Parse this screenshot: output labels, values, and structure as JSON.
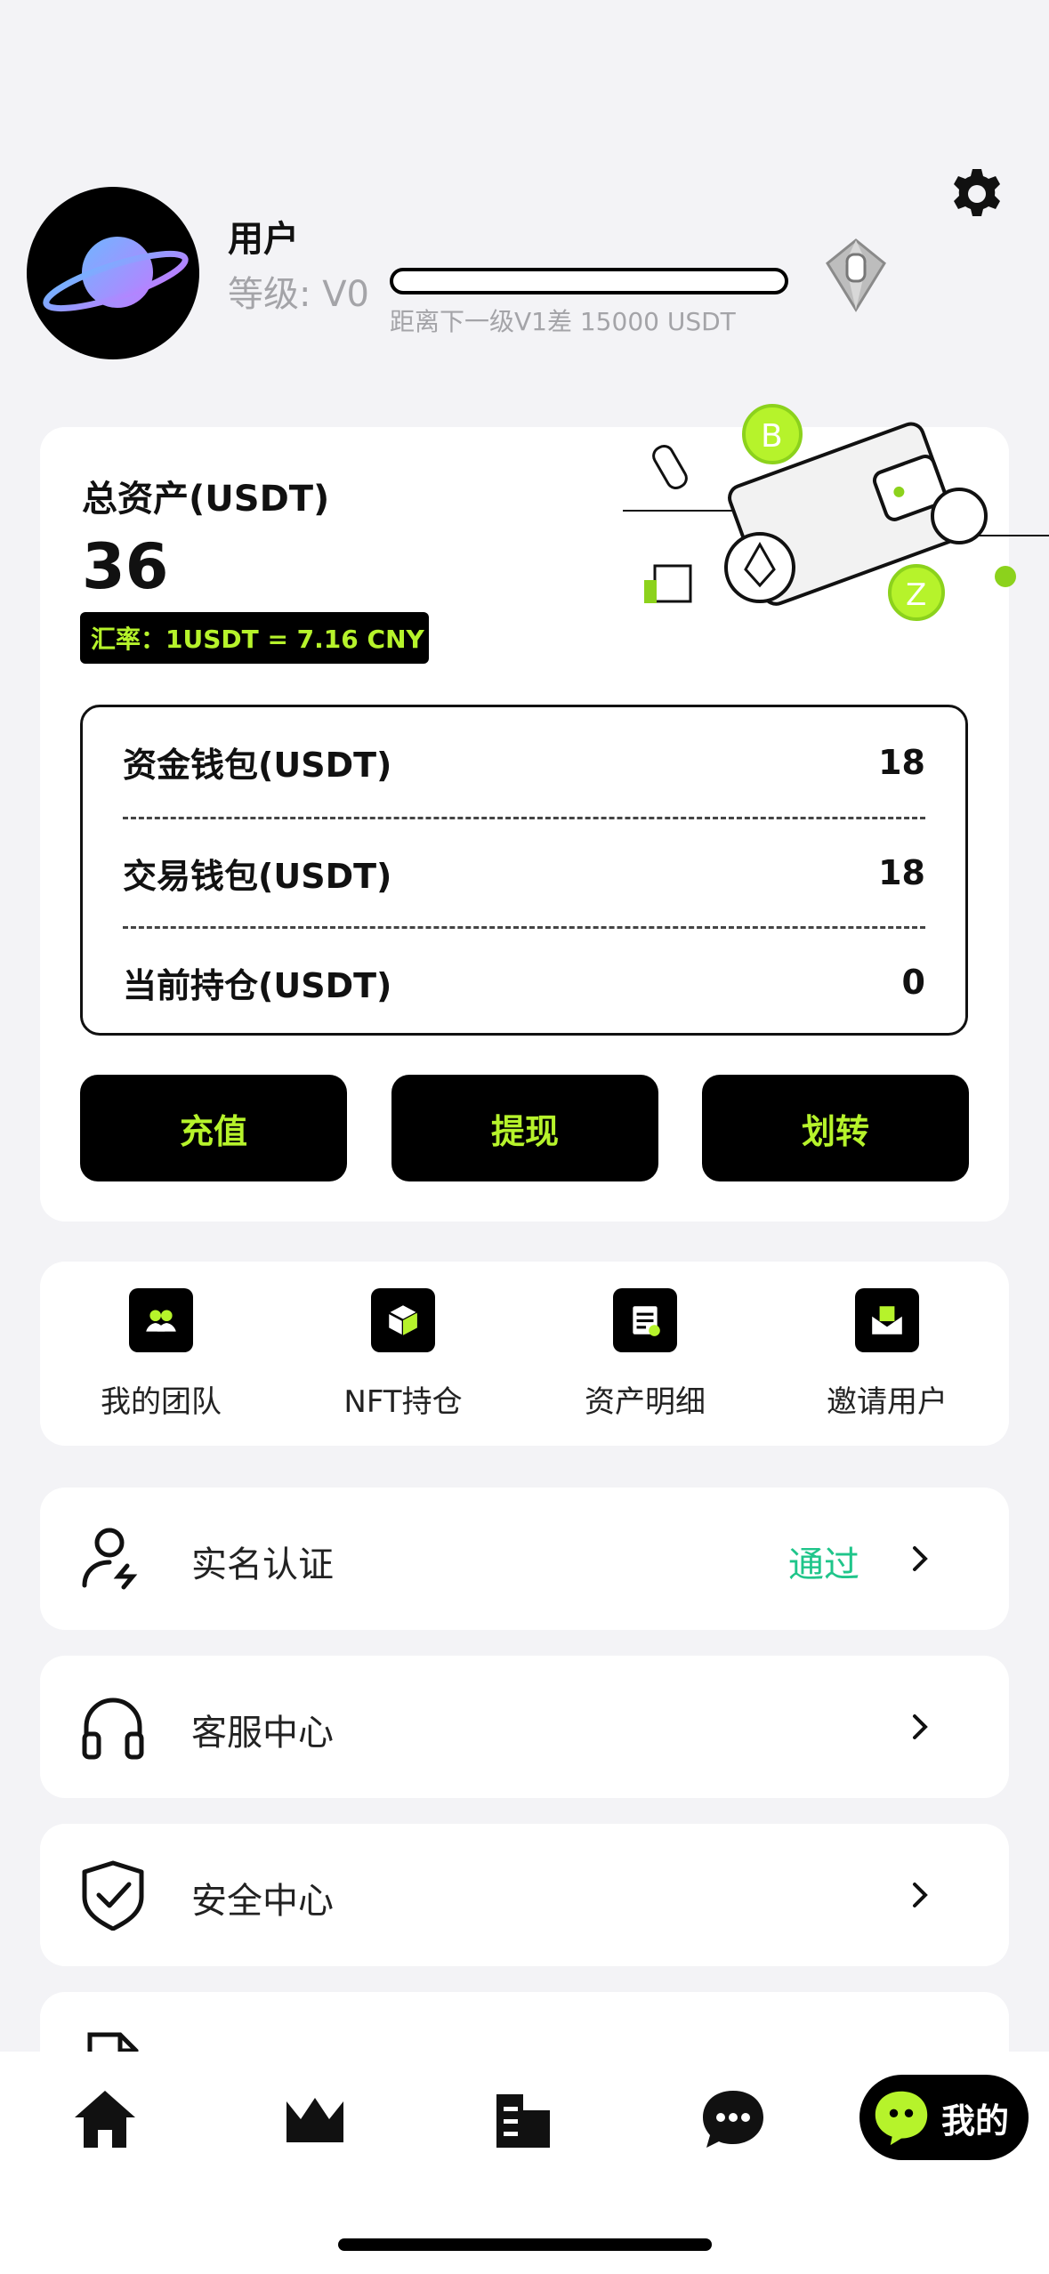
{
  "profile": {
    "username": "用户",
    "level_label": "等级: V0",
    "level_progress": 0,
    "next_level_text": "距离下一级V1差 15000 USDT"
  },
  "assets": {
    "label": "总资产(USDT)",
    "value": "36",
    "rate": "汇率：1USDT = 7.16 CNY",
    "wallets": [
      {
        "label": "资金钱包(USDT)",
        "value": "18"
      },
      {
        "label": "交易钱包(USDT)",
        "value": "18"
      },
      {
        "label": "当前持仓(USDT)",
        "value": "0"
      }
    ],
    "actions": {
      "recharge": "充值",
      "withdraw": "提现",
      "transfer": "划转"
    }
  },
  "quick_links": [
    {
      "label": "我的团队",
      "icon": "team-icon"
    },
    {
      "label": "NFT持仓",
      "icon": "nft-box-icon"
    },
    {
      "label": "资产明细",
      "icon": "asset-detail-icon"
    },
    {
      "label": "邀请用户",
      "icon": "invite-mail-icon"
    }
  ],
  "menu": [
    {
      "label": "实名认证",
      "status": "通过",
      "icon": "user-verify-icon"
    },
    {
      "label": "客服中心",
      "status": "",
      "icon": "headset-icon"
    },
    {
      "label": "安全中心",
      "status": "",
      "icon": "shield-check-icon"
    }
  ],
  "nav": {
    "items": [
      "home-icon",
      "crown-icon",
      "building-icon",
      "chat-icon"
    ],
    "active_label": "我的"
  },
  "colors": {
    "accent": "#b6f32b",
    "background": "#f3f3f6",
    "verified": "#1fc58a"
  }
}
